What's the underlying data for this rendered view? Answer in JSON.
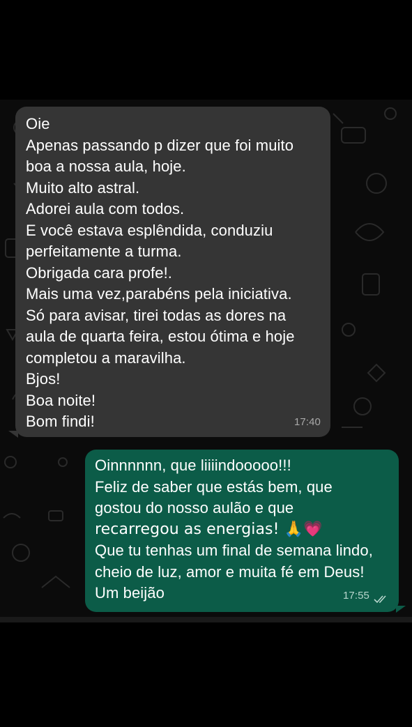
{
  "chat": {
    "incoming": {
      "lines": [
        "Oie",
        "Apenas passando p dizer que foi muito",
        "boa a nossa aula, hoje.",
        "Muito alto astral.",
        "Adorei aula com todos.",
        "E você estava esplêndida, conduziu",
        "perfeitamente a turma.",
        "Obrigada cara profe!.",
        "Mais uma vez,parabéns pela iniciativa.",
        "Só para avisar, tirei todas as dores na",
        "aula de  quarta feira, estou ótima e hoje",
        "completou a maravilha.",
        "Bjos!",
        "Boa noite!",
        "Bom findi!"
      ],
      "time": "17:40"
    },
    "outgoing": {
      "lines": [
        "Oinnnnnn, que liiiindooooo!!!",
        "Feliz de saber que estás bem, que",
        "gostou do nosso aulão e que",
        "recarregou as energias! 🙏💗",
        "Que tu tenhas um final de semana lindo,",
        "cheio de luz, amor e muita fé em Deus!",
        "Um beijão"
      ],
      "time": "17:55",
      "status_icon": "double-check-icon"
    }
  },
  "colors": {
    "background": "#000000",
    "wallpaper": "#0b0b0b",
    "incoming_bubble": "#353535",
    "outgoing_bubble": "#0c5c48",
    "text": "#ffffff",
    "timestamp": "#a9a9a9"
  }
}
